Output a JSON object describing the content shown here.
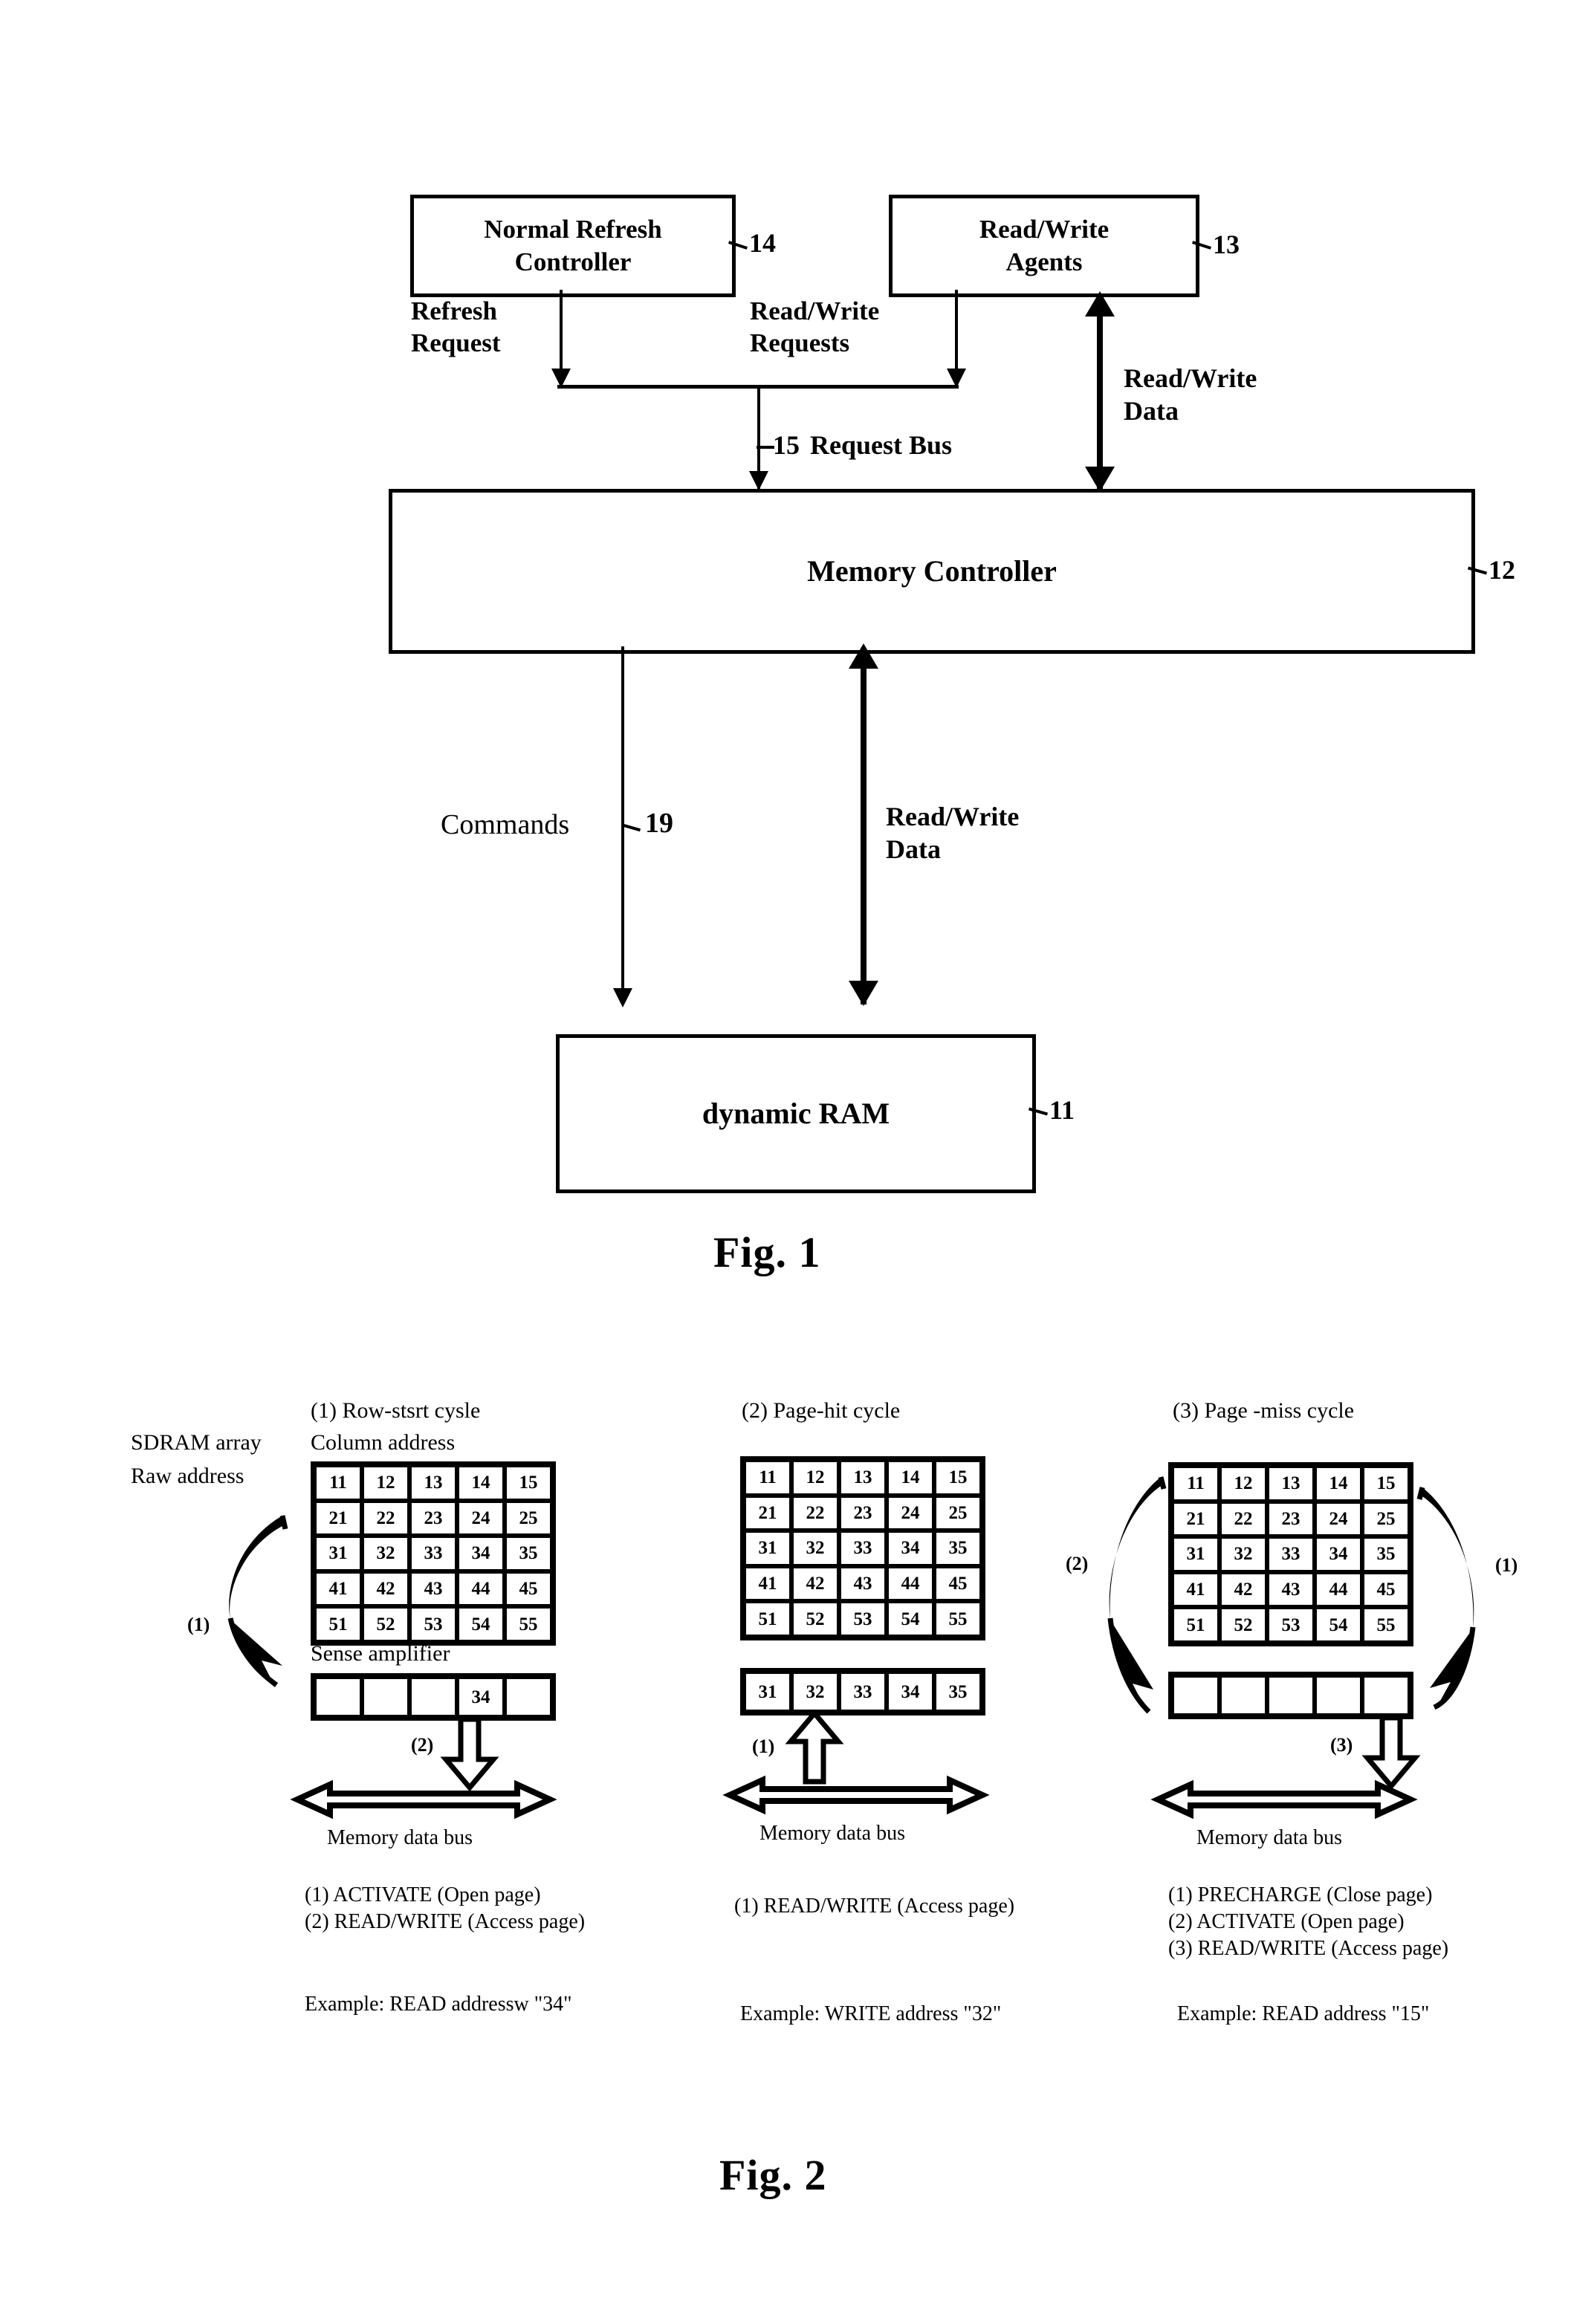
{
  "figure1": {
    "caption": "Fig. 1",
    "blocks": [
      {
        "id": "normal-refresh-controller",
        "line1": "Normal Refresh",
        "line2": "Controller",
        "ref": "14"
      },
      {
        "id": "read-write-agents",
        "line1": "Read/Write",
        "line2": "Agents",
        "ref": "13"
      },
      {
        "id": "memory-controller",
        "line1": "Memory Controller",
        "line2": "",
        "ref": "12"
      },
      {
        "id": "dynamic-ram",
        "line1": "dynamic RAM",
        "line2": "",
        "ref": "11"
      }
    ],
    "labels": {
      "refresh_request": "Refresh\nRequest",
      "read_write_requests": "Read/Write\nRequests",
      "read_write_data_upper": "Read/Write\nData",
      "request_bus_ref": "15",
      "request_bus": "Request Bus",
      "commands": "Commands",
      "commands_ref": "19",
      "read_write_data_lower": "Read/Write\nData"
    }
  },
  "figure2": {
    "caption": "Fig. 2",
    "side_labels": {
      "sdram_array": "SDRAM  array",
      "raw_address": "Raw address"
    },
    "grid_rows": [
      [
        "11",
        "12",
        "13",
        "14",
        "15"
      ],
      [
        "21",
        "22",
        "23",
        "24",
        "25"
      ],
      [
        "31",
        "32",
        "33",
        "34",
        "35"
      ],
      [
        "41",
        "42",
        "43",
        "44",
        "45"
      ],
      [
        "51",
        "52",
        "53",
        "54",
        "55"
      ]
    ],
    "memory_data_bus_label": "Memory data bus",
    "columns": [
      {
        "id": "row-start-cycle",
        "title": "(1) Row-stsrt cysle",
        "column_address_label": "Column address",
        "sense_amplifier_label": "Sense amplifier",
        "sense_amplifier_cells": [
          "",
          "",
          "",
          "34",
          ""
        ],
        "curved_arrow_label": "(1)",
        "vertical_arrow_label": "(2)",
        "vertical_arrow_direction": "down",
        "steps": [
          "(1) ACTIVATE (Open page)",
          "(2) READ/WRITE (Access page)"
        ],
        "example": "Example: READ addressw \"34\""
      },
      {
        "id": "page-hit-cycle",
        "title": "(2) Page-hit cycle",
        "column_address_label": "",
        "sense_amplifier_label": "",
        "sense_amplifier_cells": [
          "31",
          "32",
          "33",
          "34",
          "35"
        ],
        "curved_arrow_label": "",
        "vertical_arrow_label": "(1)",
        "vertical_arrow_direction": "up",
        "steps": [
          "(1) READ/WRITE (Access page)"
        ],
        "example": "Example: WRITE address \"32\""
      },
      {
        "id": "page-miss-cycle",
        "title": "(3) Page -miss cycle",
        "column_address_label": "",
        "sense_amplifier_label": "",
        "sense_amplifier_cells": [
          "",
          "",
          "",
          "",
          ""
        ],
        "curved_arrow_label": "(2)",
        "curved_arrow_label_right": "(1)",
        "vertical_arrow_label": "(3)",
        "vertical_arrow_direction": "down",
        "steps": [
          "(1) PRECHARGE (Close page)",
          "(2) ACTIVATE (Open page)",
          "(3) READ/WRITE (Access page)"
        ],
        "example": "Example: READ address \"15\""
      }
    ]
  }
}
